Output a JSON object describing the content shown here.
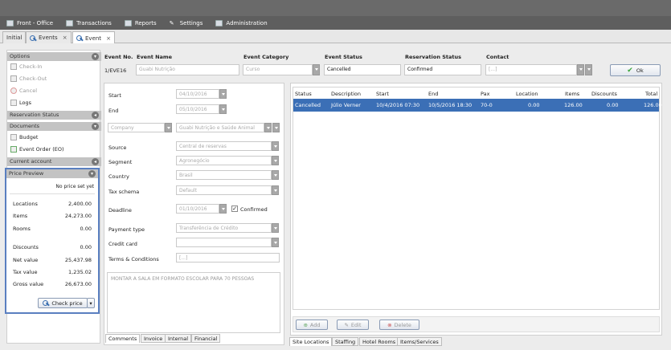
{
  "menu": {
    "items": [
      {
        "label": "Front - Office"
      },
      {
        "label": "Transactions"
      },
      {
        "label": "Reports"
      },
      {
        "label": "Settings"
      },
      {
        "label": "Administration"
      }
    ]
  },
  "tabs": [
    {
      "label": "Initial"
    },
    {
      "label": "Events"
    },
    {
      "label": "Event"
    }
  ],
  "sidebar": {
    "options_title": "Options",
    "options": [
      {
        "label": "Check-In",
        "enabled": false
      },
      {
        "label": "Check-Out",
        "enabled": false
      },
      {
        "label": "Cancel",
        "enabled": false
      },
      {
        "label": "Logs",
        "enabled": true
      }
    ],
    "reservation_status": "Reservation Status",
    "documents_title": "Documents",
    "documents": [
      {
        "label": "Budget"
      },
      {
        "label": "Event Order (EO)"
      }
    ],
    "current_account": "Current account",
    "price_preview_title": "Price Preview",
    "no_price": "No price set yet",
    "prices": [
      {
        "label": "Locations",
        "value": "2,400.00"
      },
      {
        "label": "Items",
        "value": "24,273.00"
      },
      {
        "label": "Rooms",
        "value": "0.00"
      },
      {
        "label": "Discounts",
        "value": "0.00"
      },
      {
        "label": "Net value",
        "value": "25,437.98"
      },
      {
        "label": "Tax value",
        "value": "1,235.02"
      },
      {
        "label": "Gross value",
        "value": "26,673.00"
      }
    ],
    "check_price": "Check price"
  },
  "header": {
    "event_no_label": "Event No.",
    "event_no": "1/EVE16",
    "event_name_label": "Event Name",
    "event_name": "Guabi Nutrição",
    "event_category_label": "Event Category",
    "event_category": "Curso",
    "event_status_label": "Event Status",
    "event_status": "Cancelled",
    "reservation_status_label": "Reservation Status",
    "reservation_status": "Confirmed",
    "contact_label": "Contact",
    "contact": "[...]",
    "ok": "Ok"
  },
  "form": {
    "start_label": "Start",
    "start": "04/10/2016",
    "end_label": "End",
    "end": "05/10/2016",
    "company": "Company",
    "company_name": "Guabi Nutrição e Saúde Animal",
    "source_label": "Source",
    "source": "Central de reservas",
    "segment_label": "Segment",
    "segment": "Agronegócio",
    "country_label": "Country",
    "country": "Brasil",
    "tax_label": "Tax schema",
    "tax": "Default",
    "deadline_label": "Deadline",
    "deadline": "01/10/2016",
    "confirmed": "Confirmed",
    "payment_label": "Payment type",
    "payment": "Transferência de Crédito",
    "credit_label": "Credit card",
    "terms_label": "Terms & Conditions",
    "terms": "[...]",
    "comment": "MONTAR A SALA EM FORMATO ESCOLAR PARA 70 PESSOAS",
    "bottom_tabs": [
      "Comments",
      "Invoice",
      "Internal",
      "Financial"
    ]
  },
  "locations": {
    "columns": [
      "Status",
      "Description",
      "Start",
      "End",
      "Pax",
      "Location",
      "Items",
      "Discounts",
      "Total"
    ],
    "rows": [
      {
        "status": "Cancelled",
        "description": "Júlio Verner",
        "start": "10/4/2016 07:30",
        "end": "10/5/2016 18:30",
        "pax": "70-0",
        "location": "0.00",
        "items": "126.00",
        "discounts": "0.00",
        "total": "126.00"
      }
    ],
    "add": "Add",
    "edit": "Edit",
    "delete": "Delete",
    "bottom_tabs": [
      "Site Locations",
      "Staffing",
      "Hotel Rooms",
      "Items/Services"
    ]
  },
  "colors": {
    "selected_row": "#3b6fb6",
    "highlight_border": "#5a7fc0",
    "ok_check": "#3aa53a"
  }
}
